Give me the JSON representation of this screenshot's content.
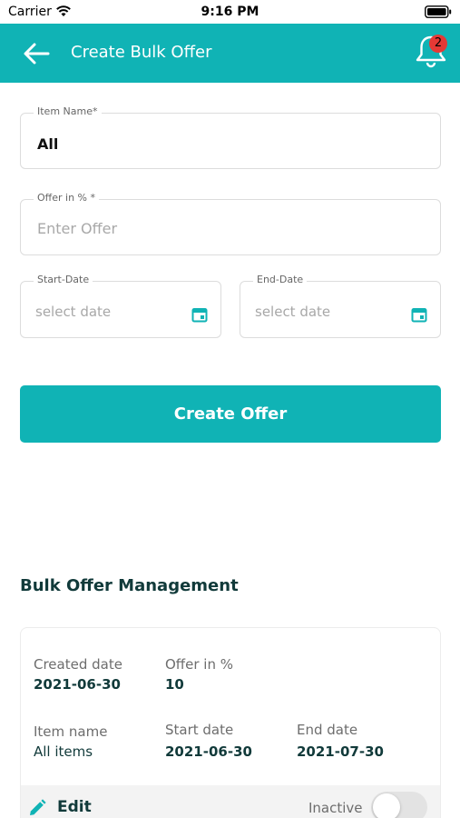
{
  "status_bar": {
    "carrier": "Carrier",
    "time": "9:16 PM"
  },
  "header": {
    "title": "Create Bulk Offer",
    "notification_count": "2"
  },
  "form": {
    "item_name": {
      "label": "Item Name*",
      "value": "All"
    },
    "offer": {
      "label": "Offer in % *",
      "placeholder": "Enter Offer"
    },
    "start_date": {
      "label": "Start-Date",
      "placeholder": "select date"
    },
    "end_date": {
      "label": "End-Date",
      "placeholder": "select date"
    },
    "submit_label": "Create Offer"
  },
  "management": {
    "title": "Bulk Offer Management",
    "offers": [
      {
        "created_label": "Created date",
        "created_value": "2021-06-30",
        "offer_label": "Offer in %",
        "offer_value": "10",
        "item_label": "Item name",
        "item_value": "All items",
        "start_label": "Start date",
        "start_value": "2021-06-30",
        "end_label": "End date",
        "end_value": "2021-07-30",
        "edit_label": "Edit",
        "status_label": "Inactive"
      }
    ]
  },
  "colors": {
    "accent": "#10b3b5",
    "badge": "#e53935",
    "text_dark": "#113a3a"
  },
  "icons": [
    "wifi-icon",
    "battery-icon",
    "back-arrow-icon",
    "bell-icon",
    "calendar-icon",
    "pencil-icon"
  ]
}
